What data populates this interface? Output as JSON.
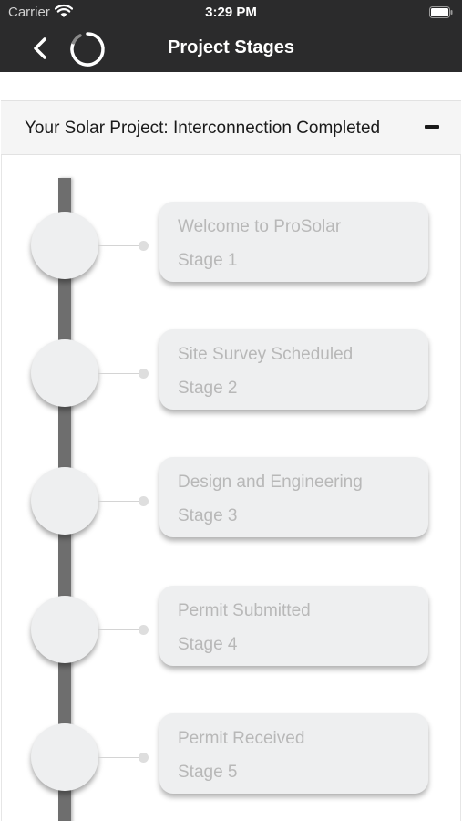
{
  "status_bar": {
    "carrier": "Carrier",
    "time": "3:29 PM",
    "wifi_icon": "wifi-icon",
    "battery_icon": "battery-icon"
  },
  "nav_bar": {
    "title": "Project Stages",
    "back_icon": "chevron-left-icon",
    "loading_icon": "spinner-icon",
    "background": "#2b2b2c"
  },
  "section": {
    "title": "Your Solar Project: Interconnection Completed",
    "collapse_icon": "minus-icon"
  },
  "stages": [
    {
      "name": "Welcome to ProSolar",
      "number": "Stage 1"
    },
    {
      "name": "Site Survey Scheduled",
      "number": "Stage 2"
    },
    {
      "name": "Design and Engineering",
      "number": "Stage 3"
    },
    {
      "name": "Permit Submitted",
      "number": "Stage 4"
    },
    {
      "name": "Permit Received",
      "number": "Stage 5"
    }
  ],
  "colors": {
    "timeline": "#6e6e6e",
    "card": "#eeeff0",
    "card_text": "#b8b8b8"
  }
}
